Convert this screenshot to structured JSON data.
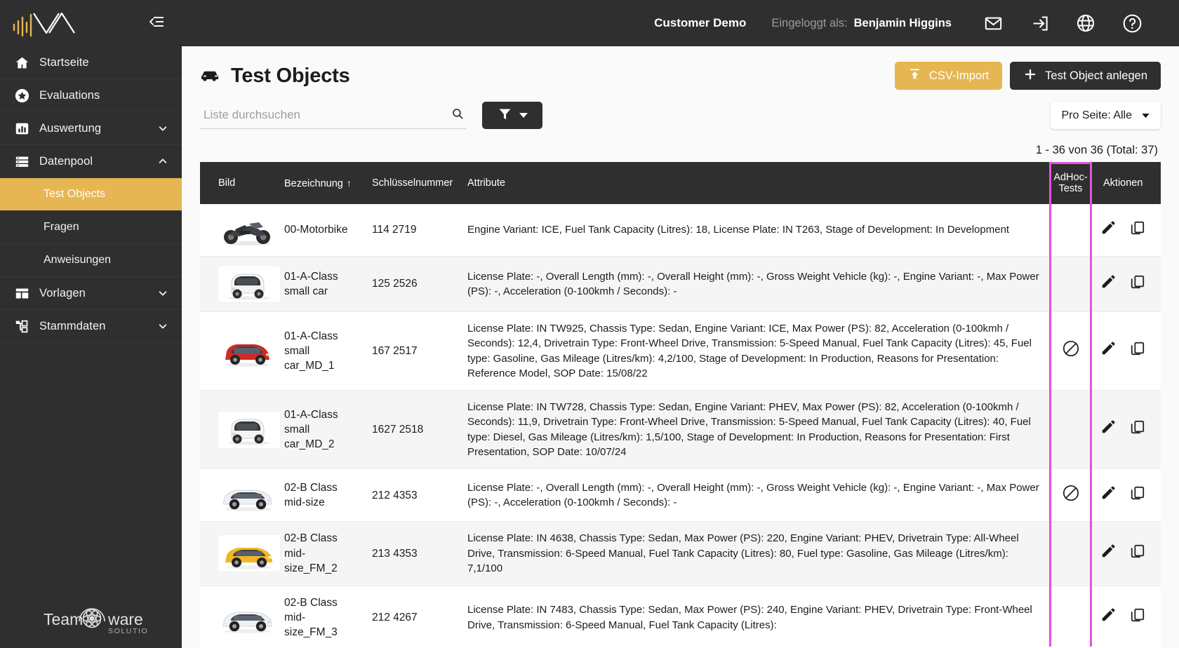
{
  "brand": {
    "accent": "#e6b653",
    "dark": "#302f2f",
    "highlight": "#e252e2",
    "footer_logo_main": "Team",
    "footer_logo_mid": "ware",
    "footer_logo_sub": "SOLUTIONS"
  },
  "topbar": {
    "customer": "Customer Demo",
    "logged_in_label": "Eingeloggt als:",
    "user": "Benjamin Higgins",
    "icons": [
      "mail-icon",
      "logout-icon",
      "globe-icon",
      "help-icon"
    ]
  },
  "sidebar": {
    "items": [
      {
        "label": "Startseite",
        "icon": "home-icon",
        "chevron": "",
        "active": false
      },
      {
        "label": "Evaluations",
        "icon": "star-icon",
        "chevron": "",
        "active": false
      },
      {
        "label": "Auswertung",
        "icon": "chart-icon",
        "chevron": "down",
        "active": false
      },
      {
        "label": "Datenpool",
        "icon": "list-icon",
        "chevron": "up",
        "active": false
      }
    ],
    "sub_items": [
      {
        "label": "Test Objects",
        "active": true
      },
      {
        "label": "Fragen",
        "active": false
      },
      {
        "label": "Anweisungen",
        "active": false
      }
    ],
    "items_after": [
      {
        "label": "Vorlagen",
        "icon": "template-icon",
        "chevron": "down",
        "active": false
      },
      {
        "label": "Stammdaten",
        "icon": "hierarchy-icon",
        "chevron": "down",
        "active": false
      }
    ]
  },
  "page": {
    "title": "Test Objects",
    "title_icon": "car-icon",
    "csv_button": "CSV-Import",
    "csv_icon": "upload-icon",
    "create_button": "Test Object anlegen",
    "create_icon": "plus-icon",
    "search_placeholder": "Liste durchsuchen",
    "search_value": "",
    "search_icon": "search-icon",
    "filter_icon": "funnel-icon",
    "filter_caret": "caret-down-icon",
    "per_page": "Pro Seite: Alle",
    "per_page_caret": "caret-down-icon",
    "count": "1 - 36 von 36 (Total: 37)"
  },
  "table": {
    "headers": {
      "bild": "Bild",
      "bezeichnung": "Bezeichnung",
      "sort_arrow": "↑",
      "schluesselnummer": "Schlüsselnummer",
      "attribute": "Attribute",
      "adhoc": "AdHoc-Tests",
      "aktionen": "Aktionen"
    },
    "rows": [
      {
        "thumb": "motorbike-thumb",
        "boxed": false,
        "bezeichnung": "00-Motorbike",
        "schluesselnummer": "114 2719",
        "attribute": "Engine Variant: ICE, Fuel Tank Capacity (Litres): 18, License Plate: IN T263, Stage of Development: In Development",
        "adhoc": "",
        "actions": [
          "edit-icon",
          "copy-icon"
        ]
      },
      {
        "thumb": "microcar-thumb",
        "boxed": true,
        "bezeichnung": "01-A-Class small car",
        "schluesselnummer": "125 2526",
        "attribute": "License Plate: -, Overall Length (mm): -, Overall Height (mm): -, Gross Weight Vehicle (kg): -, Engine Variant: -, Max Power (PS): -, Acceleration (0-100kmh / Seconds): -",
        "adhoc": "",
        "actions": [
          "edit-icon",
          "copy-icon"
        ]
      },
      {
        "thumb": "redcar-thumb",
        "boxed": false,
        "bezeichnung": "01-A-Class small car_MD_1",
        "schluesselnummer": "167 2517",
        "attribute": "License Plate: IN TW925, Chassis Type: Sedan, Engine Variant: ICE, Max Power (PS): 82, Acceleration (0-100kmh / Seconds): 12,4, Drivetrain Type: Front-Wheel Drive, Transmission: 5-Speed Manual, Fuel Tank Capacity (Litres): 45, Fuel type: Gasoline, Gas Mileage (Litres/km): 4,2/100, Stage of Development: In Production, Reasons for Presentation: Reference Model, SOP Date: 15/08/22",
        "adhoc": "blocked-icon",
        "actions": [
          "edit-icon",
          "copy-icon"
        ]
      },
      {
        "thumb": "microcar-thumb",
        "boxed": true,
        "bezeichnung": "01-A-Class small car_MD_2",
        "schluesselnummer": "1627 2518",
        "attribute": "License Plate: IN TW728, Chassis Type: Sedan, Engine Variant: PHEV, Max Power (PS): 82, Acceleration (0-100kmh / Seconds): 11,9, Drivetrain Type: Front-Wheel Drive, Transmission: 5-Speed Manual, Fuel Tank Capacity (Litres): 40, Fuel type: Diesel, Gas Mileage (Litres/km): 1,5/100, Stage of Development: In Production, Reasons for Presentation: First Presentation, SOP Date: 10/07/24",
        "adhoc": "",
        "actions": [
          "edit-icon",
          "copy-icon"
        ]
      },
      {
        "thumb": "whitecar-thumb",
        "boxed": false,
        "bezeichnung": "02-B Class mid-size",
        "schluesselnummer": "212 4353",
        "attribute": "License Plate: -, Overall Length (mm): -, Overall Height (mm): -, Gross Weight Vehicle (kg): -, Engine Variant: -, Max Power (PS): -, Acceleration (0-100kmh / Seconds): -",
        "adhoc": "blocked-icon",
        "actions": [
          "edit-icon",
          "copy-icon"
        ]
      },
      {
        "thumb": "yellowcar-thumb",
        "boxed": true,
        "bezeichnung": "02-B Class mid-size_FM_2",
        "schluesselnummer": "213 4353",
        "attribute": "License Plate: IN 4638, Chassis Type: Sedan, Max Power (PS): 220, Engine Variant: PHEV, Drivetrain Type: All-Wheel Drive, Transmission: 6-Speed Manual, Fuel Tank Capacity (Litres): 80, Fuel type: Gasoline, Gas Mileage (Litres/km): 7,1/100",
        "adhoc": "",
        "actions": [
          "edit-icon",
          "copy-icon"
        ]
      },
      {
        "thumb": "whitecar-thumb",
        "boxed": false,
        "bezeichnung": "02-B Class mid-size_FM_3",
        "schluesselnummer": "212 4267",
        "attribute": "License Plate: IN 7483, Chassis Type: Sedan, Max Power (PS): 240, Engine Variant: PHEV, Drivetrain Type: Front-Wheel Drive, Transmission: 6-Speed Manual, Fuel Tank Capacity (Litres):",
        "adhoc": "",
        "actions": [
          "edit-icon",
          "copy-icon"
        ]
      }
    ]
  }
}
